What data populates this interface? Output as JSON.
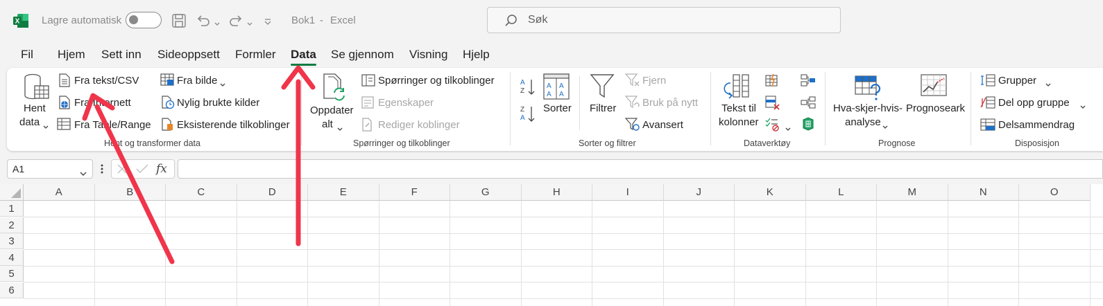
{
  "titlebar": {
    "autosave_label": "Lagre automatisk",
    "doc_title": "Bok1",
    "separator": "-",
    "app_name": "Excel",
    "search_placeholder": "Søk"
  },
  "tabs": [
    {
      "label": "Fil"
    },
    {
      "label": "Hjem"
    },
    {
      "label": "Sett inn"
    },
    {
      "label": "Sideoppsett"
    },
    {
      "label": "Formler"
    },
    {
      "label": "Data",
      "active": true
    },
    {
      "label": "Se gjennom"
    },
    {
      "label": "Visning"
    },
    {
      "label": "Hjelp"
    }
  ],
  "ribbon": {
    "get_data": {
      "hent_line1": "Hent",
      "hent_line2": "data",
      "fra_tekst": "Fra tekst/CSV",
      "fra_nett": "Fra Internett",
      "fra_tabell": "Fra Table/Range",
      "fra_bilde": "Fra bilde",
      "nylig": "Nylig brukte kilder",
      "eksisterende": "Eksisterende tilkoblinger",
      "group": "Hent og transformer data"
    },
    "queries": {
      "oppdater_line1": "Oppdater",
      "oppdater_line2": "alt",
      "sporringer": "Spørringer og tilkoblinger",
      "egenskaper": "Egenskaper",
      "rediger": "Rediger koblinger",
      "group": "Spørringer og tilkoblinger"
    },
    "sort": {
      "sorter": "Sorter",
      "filtrer": "Filtrer",
      "fjern": "Fjern",
      "bruk": "Bruk på nytt",
      "avansert": "Avansert",
      "group": "Sorter og filtrer"
    },
    "tools": {
      "tekst_line1": "Tekst til",
      "tekst_line2": "kolonner",
      "group": "Dataverktøy"
    },
    "forecast": {
      "hva_line1": "Hva-skjer-hvis-",
      "hva_line2": "analyse",
      "prognoseark": "Prognoseark",
      "group": "Prognose"
    },
    "outline": {
      "grupper": "Grupper",
      "del_opp": "Del opp gruppe",
      "delsammendrag": "Delsammendrag",
      "group": "Disposisjon"
    }
  },
  "formula_bar": {
    "name_box": "A1",
    "fx": "fx",
    "value": ""
  },
  "grid": {
    "columns": [
      "A",
      "B",
      "C",
      "D",
      "E",
      "F",
      "G",
      "H",
      "I",
      "J",
      "K",
      "L",
      "M",
      "N",
      "O"
    ],
    "rows": [
      "1",
      "2",
      "3",
      "4",
      "5",
      "6"
    ]
  },
  "colors": {
    "accent": "#107c41",
    "annotation_arrow": "#f0354a"
  }
}
